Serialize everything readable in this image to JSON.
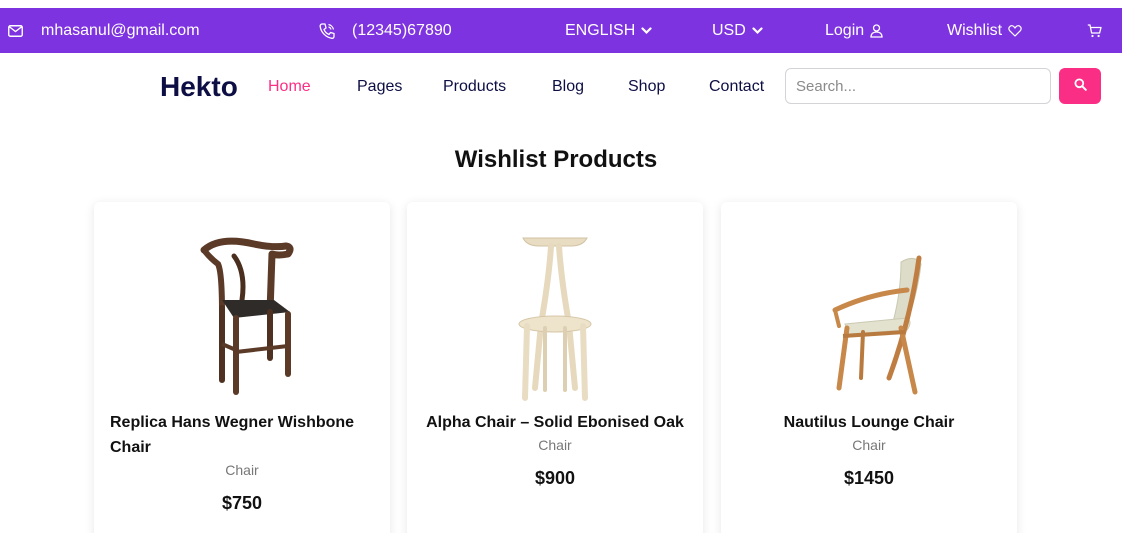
{
  "topbar": {
    "email": "mhasanul@gmail.com",
    "phone": "(12345)67890",
    "language": "ENGLISH",
    "currency": "USD",
    "login_label": "Login",
    "wishlist_label": "Wishlist",
    "icons": [
      "mail-icon",
      "phone-icon",
      "chevron-down-icon",
      "user-icon",
      "heart-icon",
      "cart-icon"
    ]
  },
  "navbar": {
    "logo": "Hekto",
    "links": [
      "Home",
      "Pages",
      "Products",
      "Blog",
      "Shop",
      "Contact"
    ],
    "active_link": "Home",
    "search_placeholder": "Search..."
  },
  "page": {
    "title": "Wishlist Products"
  },
  "products": [
    {
      "name": "Replica Hans Wegner Wishbone Chair",
      "category": "Chair",
      "price": "$750"
    },
    {
      "name": "Alpha Chair – Solid Ebonised Oak",
      "category": "Chair",
      "price": "$900"
    },
    {
      "name": "Nautilus Lounge Chair",
      "category": "Chair",
      "price": "$1450"
    }
  ],
  "colors": {
    "topbar": "#7E33E0",
    "accent": "#FB2E86",
    "navy": "#0D0E43"
  }
}
